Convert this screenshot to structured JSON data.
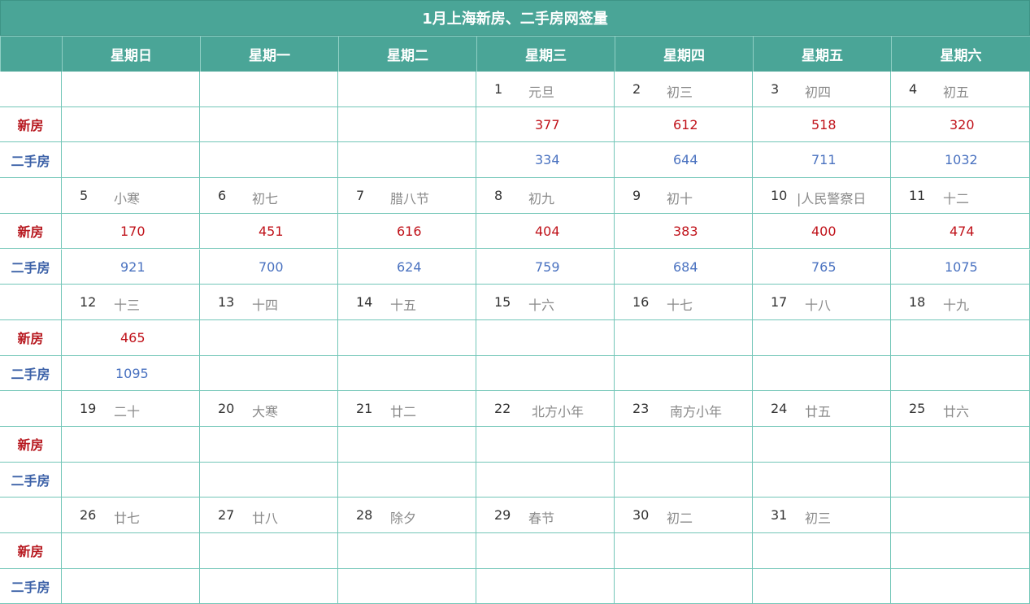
{
  "title": "1月上海新房、二手房网签量",
  "weekdays": [
    "星期日",
    "星期一",
    "星期二",
    "星期三",
    "星期四",
    "星期五",
    "星期六"
  ],
  "row_labels": {
    "new": "新房",
    "secondhand": "二手房"
  },
  "colors": {
    "header_bg": "#4aa597",
    "new_text": "#c0121a",
    "secondhand_text": "#4a72c0",
    "grid": "#73c6b8"
  },
  "weeks": [
    [
      {
        "day": "",
        "lunar": "",
        "new": "",
        "secondhand": ""
      },
      {
        "day": "",
        "lunar": "",
        "new": "",
        "secondhand": ""
      },
      {
        "day": "",
        "lunar": "",
        "new": "",
        "secondhand": ""
      },
      {
        "day": "1",
        "lunar": "元旦",
        "new": "377",
        "secondhand": "334"
      },
      {
        "day": "2",
        "lunar": "初三",
        "new": "612",
        "secondhand": "644"
      },
      {
        "day": "3",
        "lunar": "初四",
        "new": "518",
        "secondhand": "711"
      },
      {
        "day": "4",
        "lunar": "初五",
        "new": "320",
        "secondhand": "1032"
      }
    ],
    [
      {
        "day": "5",
        "lunar": "小寒",
        "new": "170",
        "secondhand": "921"
      },
      {
        "day": "6",
        "lunar": "初七",
        "new": "451",
        "secondhand": "700"
      },
      {
        "day": "7",
        "lunar": "腊八节",
        "new": "616",
        "secondhand": "624"
      },
      {
        "day": "8",
        "lunar": "初九",
        "new": "404",
        "secondhand": "759"
      },
      {
        "day": "9",
        "lunar": "初十",
        "new": "383",
        "secondhand": "684"
      },
      {
        "day": "10",
        "lunar": "|人民警察日",
        "new": "400",
        "secondhand": "765"
      },
      {
        "day": "11",
        "lunar": "十二",
        "new": "474",
        "secondhand": "1075"
      }
    ],
    [
      {
        "day": "12",
        "lunar": "十三",
        "new": "465",
        "secondhand": "1095"
      },
      {
        "day": "13",
        "lunar": "十四",
        "new": "",
        "secondhand": ""
      },
      {
        "day": "14",
        "lunar": "十五",
        "new": "",
        "secondhand": ""
      },
      {
        "day": "15",
        "lunar": "十六",
        "new": "",
        "secondhand": ""
      },
      {
        "day": "16",
        "lunar": "十七",
        "new": "",
        "secondhand": ""
      },
      {
        "day": "17",
        "lunar": "十八",
        "new": "",
        "secondhand": ""
      },
      {
        "day": "18",
        "lunar": "十九",
        "new": "",
        "secondhand": ""
      }
    ],
    [
      {
        "day": "19",
        "lunar": "二十",
        "new": "",
        "secondhand": ""
      },
      {
        "day": "20",
        "lunar": "大寒",
        "new": "",
        "secondhand": ""
      },
      {
        "day": "21",
        "lunar": "廿二",
        "new": "",
        "secondhand": ""
      },
      {
        "day": "22",
        "lunar": "北方小年",
        "new": "",
        "secondhand": ""
      },
      {
        "day": "23",
        "lunar": "南方小年",
        "new": "",
        "secondhand": ""
      },
      {
        "day": "24",
        "lunar": "廿五",
        "new": "",
        "secondhand": ""
      },
      {
        "day": "25",
        "lunar": "廿六",
        "new": "",
        "secondhand": ""
      }
    ],
    [
      {
        "day": "26",
        "lunar": "廿七",
        "new": "",
        "secondhand": ""
      },
      {
        "day": "27",
        "lunar": "廿八",
        "new": "",
        "secondhand": ""
      },
      {
        "day": "28",
        "lunar": "除夕",
        "new": "",
        "secondhand": ""
      },
      {
        "day": "29",
        "lunar": "春节",
        "new": "",
        "secondhand": ""
      },
      {
        "day": "30",
        "lunar": "初二",
        "new": "",
        "secondhand": ""
      },
      {
        "day": "31",
        "lunar": "初三",
        "new": "",
        "secondhand": ""
      },
      {
        "day": "",
        "lunar": "",
        "new": "",
        "secondhand": ""
      }
    ]
  ]
}
